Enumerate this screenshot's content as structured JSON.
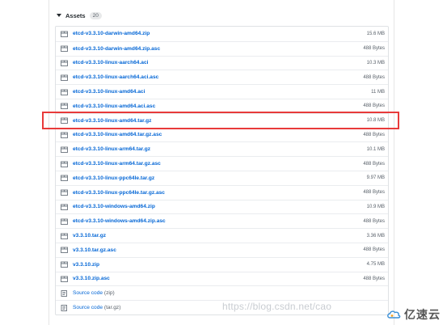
{
  "assets": {
    "title": "Assets",
    "count": "20",
    "files": [
      {
        "name": "etcd-v3.3.10-darwin-amd64.zip",
        "size": "15.6 MB"
      },
      {
        "name": "etcd-v3.3.10-darwin-amd64.zip.asc",
        "size": "488 Bytes"
      },
      {
        "name": "etcd-v3.3.10-linux-aarch64.aci",
        "size": "10.3 MB"
      },
      {
        "name": "etcd-v3.3.10-linux-aarch64.aci.asc",
        "size": "488 Bytes"
      },
      {
        "name": "etcd-v3.3.10-linux-amd64.aci",
        "size": "11 MB"
      },
      {
        "name": "etcd-v3.3.10-linux-amd64.aci.asc",
        "size": "488 Bytes"
      },
      {
        "name": "etcd-v3.3.10-linux-amd64.tar.gz",
        "size": "10.8 MB"
      },
      {
        "name": "etcd-v3.3.10-linux-amd64.tar.gz.asc",
        "size": "488 Bytes"
      },
      {
        "name": "etcd-v3.3.10-linux-arm64.tar.gz",
        "size": "10.1 MB"
      },
      {
        "name": "etcd-v3.3.10-linux-arm64.tar.gz.asc",
        "size": "488 Bytes"
      },
      {
        "name": "etcd-v3.3.10-linux-ppc64le.tar.gz",
        "size": "9.97 MB"
      },
      {
        "name": "etcd-v3.3.10-linux-ppc64le.tar.gz.asc",
        "size": "488 Bytes"
      },
      {
        "name": "etcd-v3.3.10-windows-amd64.zip",
        "size": "10.9 MB"
      },
      {
        "name": "etcd-v3.3.10-windows-amd64.zip.asc",
        "size": "488 Bytes"
      },
      {
        "name": "v3.3.10.tar.gz",
        "size": "3.36 MB"
      },
      {
        "name": "v3.3.10.tar.gz.asc",
        "size": "488 Bytes"
      },
      {
        "name": "v3.3.10.zip",
        "size": "4.75 MB"
      },
      {
        "name": "v3.3.10.zip.asc",
        "size": "488 Bytes"
      }
    ],
    "source_code": [
      {
        "label": "Source code",
        "format": "(zip)"
      },
      {
        "label": "Source code",
        "format": "(tar.gz)"
      }
    ]
  },
  "watermark": "https://blog.csdn.net/cao",
  "brand": "亿速云",
  "colors": {
    "link": "#0366d6",
    "highlight": "#e83a3a"
  }
}
